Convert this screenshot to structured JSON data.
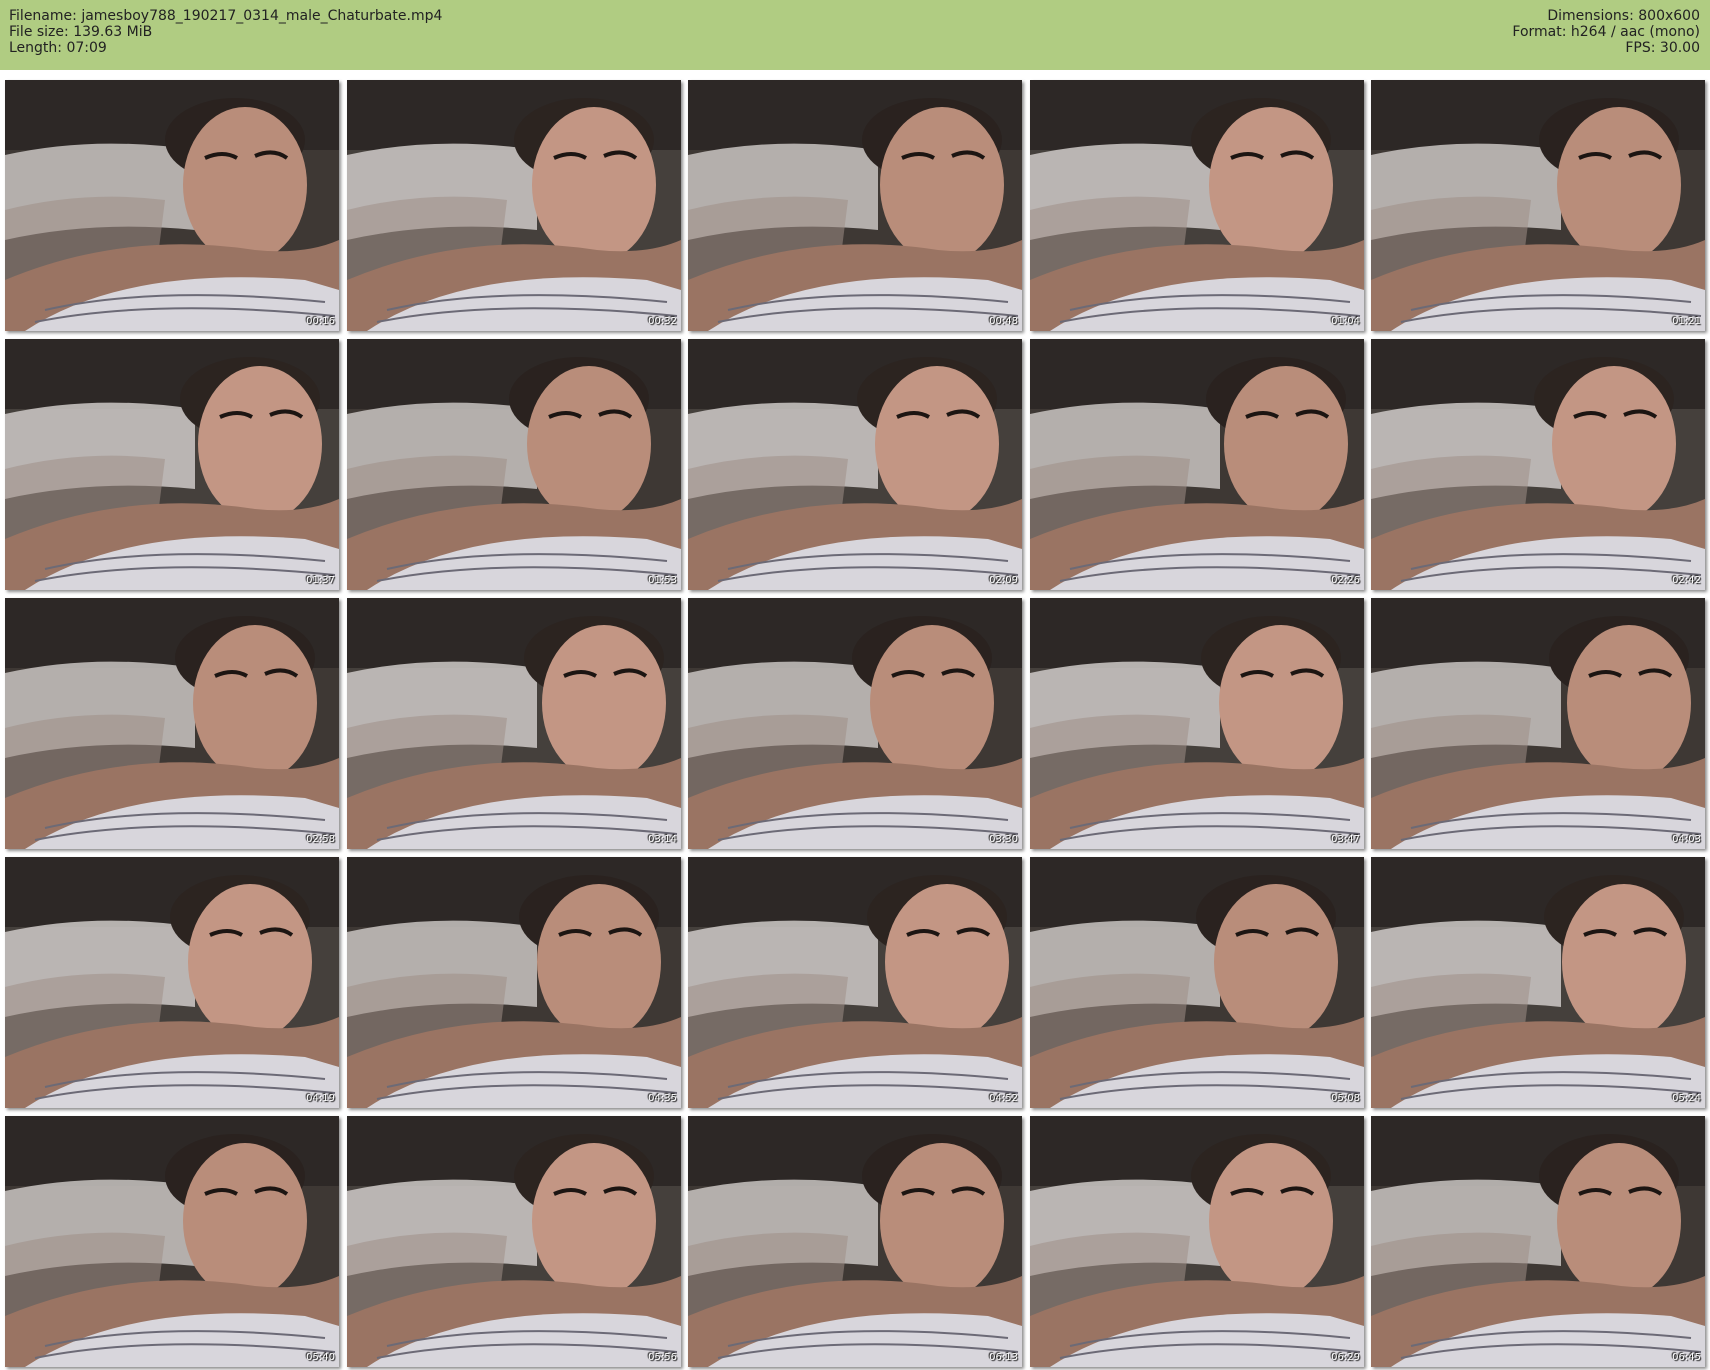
{
  "header": {
    "filename_label": "Filename:",
    "filename": "jamesboy788_190217_0314_male_Chaturbate.mp4",
    "filesize_label": "File size:",
    "filesize": "139.63 MiB",
    "length_label": "Length:",
    "length": "07:09",
    "dimensions_label": "Dimensions:",
    "dimensions": "800x600",
    "format_label": "Format:",
    "format": "h264 / aac (mono)",
    "fps_label": "FPS:",
    "fps": "30.00"
  },
  "colors": {
    "header_bg": "#b0cc82",
    "page_bg": "#ffffff",
    "timestamp_text": "#ffffff"
  },
  "thumbnails": [
    {
      "time": "00:16"
    },
    {
      "time": "00:32"
    },
    {
      "time": "00:48"
    },
    {
      "time": "01:04"
    },
    {
      "time": "01:21"
    },
    {
      "time": "01:37"
    },
    {
      "time": "01:53"
    },
    {
      "time": "02:09"
    },
    {
      "time": "02:26"
    },
    {
      "time": "02:42"
    },
    {
      "time": "02:58"
    },
    {
      "time": "03:14"
    },
    {
      "time": "03:30"
    },
    {
      "time": "03:47"
    },
    {
      "time": "04:03"
    },
    {
      "time": "04:19"
    },
    {
      "time": "04:35"
    },
    {
      "time": "04:52"
    },
    {
      "time": "05:08"
    },
    {
      "time": "05:24"
    },
    {
      "time": "05:40"
    },
    {
      "time": "05:56"
    },
    {
      "time": "06:13"
    },
    {
      "time": "06:29"
    },
    {
      "time": "06:45"
    }
  ]
}
